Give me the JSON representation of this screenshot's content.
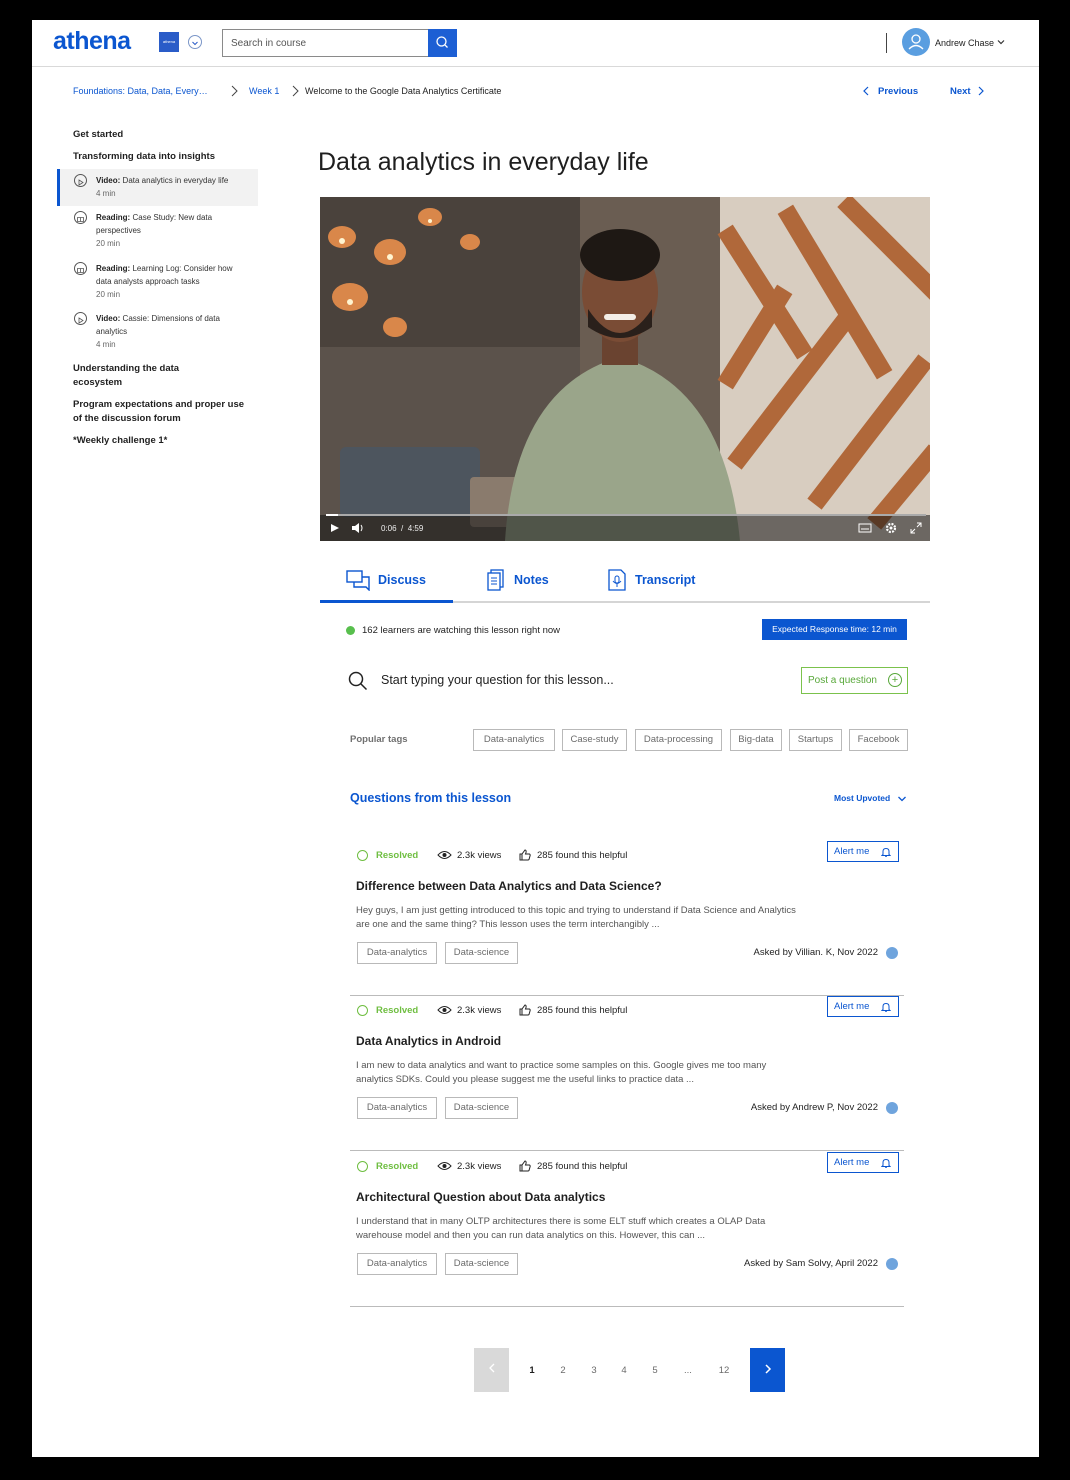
{
  "header": {
    "logo": "athena",
    "partner_logo_text": "athena",
    "search_placeholder": "Search in course",
    "user_name": "Andrew Chase"
  },
  "breadcrumb": {
    "items": [
      "Foundations: Data, Data, Every…",
      "Week 1",
      "Welcome to the Google Data Analytics Certificate"
    ],
    "previous": "Previous",
    "next": "Next"
  },
  "sidebar": {
    "get_started": "Get started",
    "section1": "Transforming data into insights",
    "items": [
      {
        "kind": "Video:",
        "title": "Data analytics in everyday life",
        "duration": "4 min"
      },
      {
        "kind": "Reading:",
        "title": "Case Study: New data perspectives",
        "duration": "20 min"
      },
      {
        "kind": "Reading:",
        "title": "Learning Log: Consider how data analysts approach tasks",
        "duration": "20 min"
      },
      {
        "kind": "Video:",
        "title": "Cassie: Dimensions of data analytics",
        "duration": "4 min"
      }
    ],
    "section2": "Understanding the data ecosystem",
    "section3": "Program expectations and proper use of the discussion forum",
    "section4": "*Weekly challenge 1*"
  },
  "lesson": {
    "title": "Data analytics in everyday life",
    "video": {
      "current_time": "0:06",
      "separator": "/",
      "duration": "4:59",
      "progress": 0.02
    }
  },
  "tabs": [
    {
      "label": "Discuss",
      "icon": "chat-bubbles-icon"
    },
    {
      "label": "Notes",
      "icon": "notes-icon"
    },
    {
      "label": "Transcript",
      "icon": "transcript-icon"
    }
  ],
  "discuss": {
    "live_text": "162 learners are watching this lesson right now",
    "response_badge": "Expected Response time: 12 min",
    "question_placeholder": "Start typing your question for this lesson...",
    "post_button": "Post a question",
    "popular_label": "Popular tags",
    "popular_tags": [
      "Data-analytics",
      "Case-study",
      "Data-processing",
      "Big-data",
      "Startups",
      "Facebook"
    ],
    "questions_heading": "Questions from this lesson",
    "sort_label": "Most Upvoted",
    "questions": [
      {
        "status": "Resolved",
        "views": "2.3k views",
        "helpful": "285 found this helpful",
        "alert": "Alert me",
        "title": "Difference between Data Analytics and Data Science?",
        "body": "Hey guys, I am just getting introduced to this topic and trying to understand if Data Science and Analytics are one and the same thing? This lesson uses the term interchangibly ...",
        "tags": [
          "Data-analytics",
          "Data-science"
        ],
        "asked": "Asked by Villian. K, Nov 2022"
      },
      {
        "status": "Resolved",
        "views": "2.3k views",
        "helpful": "285 found this helpful",
        "alert": "Alert me",
        "title": "Data Analytics in Android",
        "body": "I am new to data analytics and want to practice some samples on this. Google gives me too many analytics SDKs. Could you please suggest me the useful links to practice data ...",
        "tags": [
          "Data-analytics",
          "Data-science"
        ],
        "asked": "Asked by Andrew P, Nov 2022"
      },
      {
        "status": "Resolved",
        "views": "2.3k views",
        "helpful": "285 found this helpful",
        "alert": "Alert me",
        "title": "Architectural Question about Data analytics",
        "body": "I understand that in many OLTP architectures there is some ELT stuff which creates a OLAP Data warehouse model and then you can run data analytics on this. However, this can ...",
        "tags": [
          "Data-analytics",
          "Data-science"
        ],
        "asked": "Asked by Sam Solvy, April 2022"
      }
    ]
  },
  "pagination": {
    "prev_icon": "chevron-left-icon",
    "pages": [
      "1",
      "2",
      "3",
      "4",
      "5",
      "...",
      "12"
    ],
    "current": "1",
    "next_icon": "chevron-right-icon"
  },
  "colors": {
    "primary": "#0b56d0",
    "resolved": "#6fbe41",
    "live": "#58bf4d"
  }
}
